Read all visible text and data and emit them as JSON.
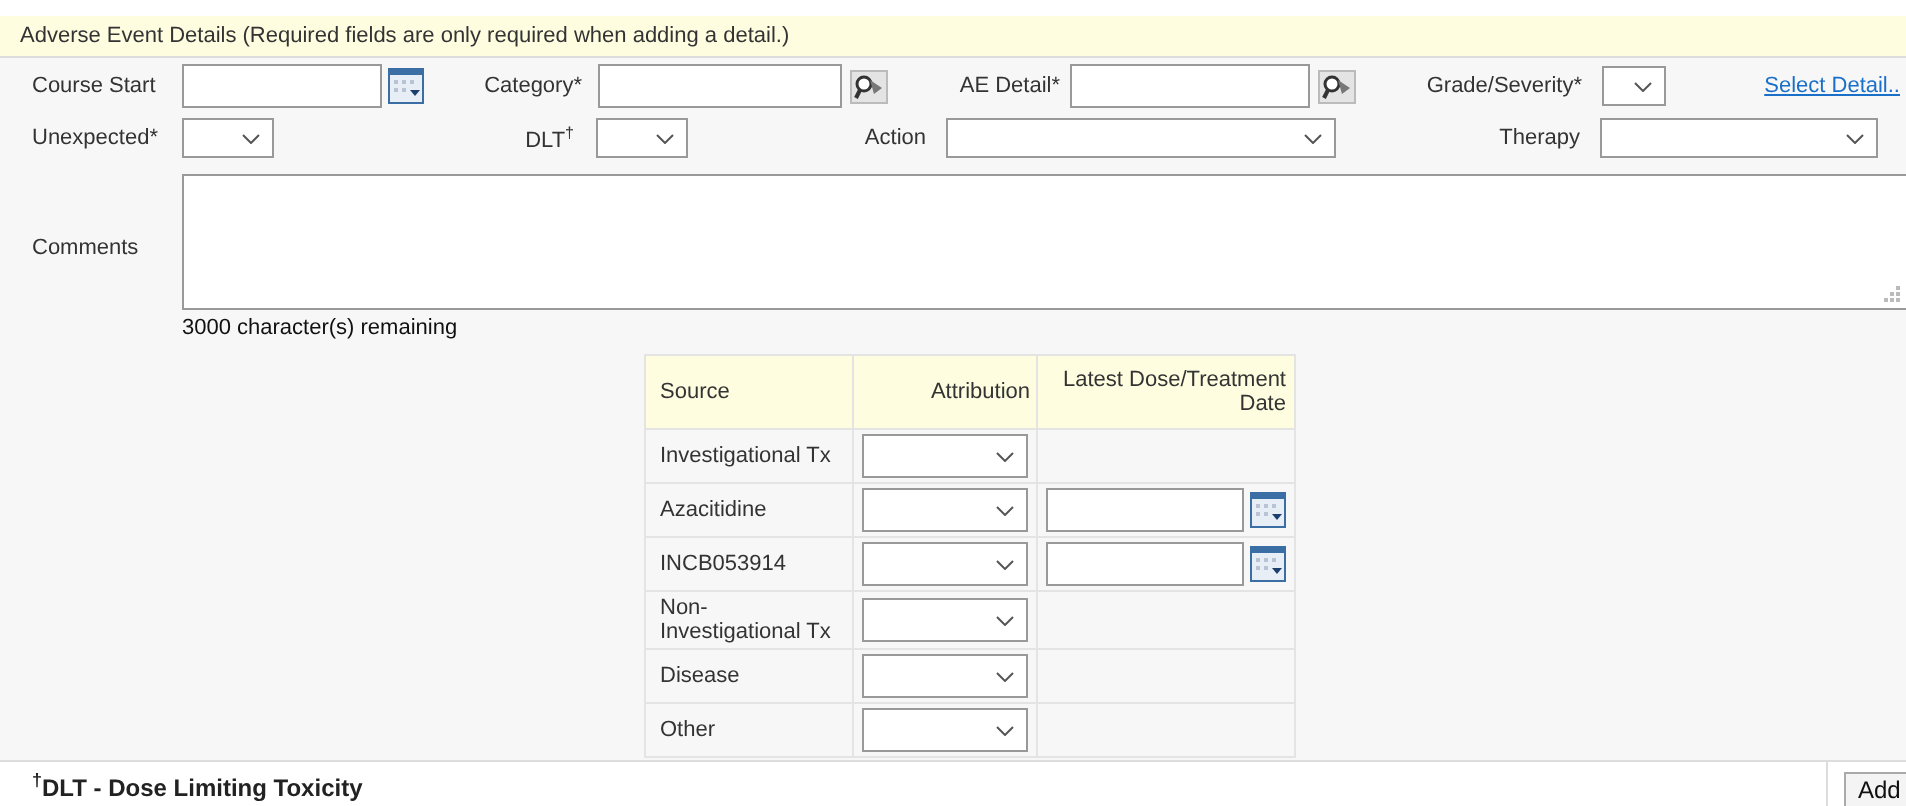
{
  "header": {
    "title": "Adverse Event Details (Required fields are only required when adding a detail.)"
  },
  "row1": [
    {
      "kind": "date",
      "label": "Course Start"
    },
    {
      "kind": "lookup",
      "label": "Category*"
    },
    {
      "kind": "lookup",
      "label": "AE Detail*"
    },
    {
      "kind": "select",
      "label": "Grade/Severity*"
    },
    {
      "kind": "link",
      "label": "Select Detail.."
    }
  ],
  "row2": [
    {
      "kind": "select",
      "label": "Unexpected*"
    },
    {
      "kind": "select",
      "label": "DLT$^{†}$"
    },
    {
      "kind": "select",
      "label": "Action"
    },
    {
      "kind": "select",
      "label": "Therapy"
    }
  ],
  "comments": {
    "label": "Comments",
    "remaining": "3000 character(s) remaining"
  },
  "attribution_table": {
    "columns": [
      "Source",
      "Attribution",
      "Latest Dose/Treatment Date"
    ],
    "rows": [
      {
        "source": "Investigational Tx",
        "kind": "plain"
      },
      {
        "source": "Azacitidine",
        "kind": "date"
      },
      {
        "source": "INCB053914",
        "kind": "date"
      },
      {
        "source": "Non-Investigational Tx",
        "kind": "plain"
      },
      {
        "source": "Disease",
        "kind": "plain"
      },
      {
        "source": "Other",
        "kind": "plain"
      }
    ]
  },
  "footer": {
    "note": "$^{†}$DLT - Dose Limiting Toxicity",
    "button": "Add"
  }
}
